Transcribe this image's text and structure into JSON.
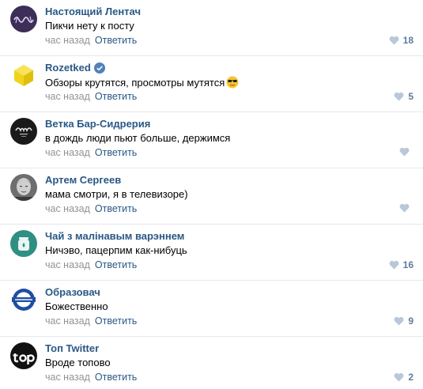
{
  "comments": [
    {
      "author": "Настоящий Лентач",
      "text": "Пикчи нету к посту",
      "time": "час назад",
      "reply": "Ответить",
      "likes": "18",
      "avatar_icon": "wave-logo-icon",
      "avatar_color": "#3d2e57"
    },
    {
      "author": "Rozetked",
      "verified": true,
      "text": "Обзоры крутятся, просмотры мутятся",
      "emoji": "sunglasses-emoji-icon",
      "time": "час назад",
      "reply": "Ответить",
      "likes": "5",
      "avatar_icon": "yellow-cube-icon",
      "avatar_color": "#f2d31b"
    },
    {
      "author": "Ветка Бар-Сидрерия",
      "text": "в дождь люди пьют больше, держимся",
      "time": "час назад",
      "reply": "Ответить",
      "likes": "",
      "avatar_icon": "vetka-logo-icon",
      "avatar_color": "#1a1a1a"
    },
    {
      "author": "Артем Сергеев",
      "text": "мама смотри, я в телевизоре)",
      "time": "час назад",
      "reply": "Ответить",
      "likes": "",
      "avatar_icon": "person-photo-icon",
      "avatar_color": "#6e6e6e"
    },
    {
      "author": "Чай з малінавым варэннем",
      "text": "Ничэво, пацерпим как-нибуць",
      "time": "час назад",
      "reply": "Ответить",
      "likes": "16",
      "avatar_icon": "tea-jar-icon",
      "avatar_color": "#2f8f82"
    },
    {
      "author": "Образовач",
      "text": "Божественно",
      "time": "час назад",
      "reply": "Ответить",
      "likes": "9",
      "avatar_icon": "underground-sign-icon",
      "avatar_color": "#1f4ea1"
    },
    {
      "author": "Топ Twitter",
      "text": "Вроде топово",
      "time": "час назад",
      "reply": "Ответить",
      "likes": "2",
      "avatar_icon": "top-logo-icon",
      "avatar_color": "#111111"
    }
  ],
  "colors": {
    "link": "#2a5885",
    "muted": "#939393",
    "like": "#5b7c9e",
    "like_heart": "#b8c7d9",
    "divider": "#e7e8ec"
  }
}
